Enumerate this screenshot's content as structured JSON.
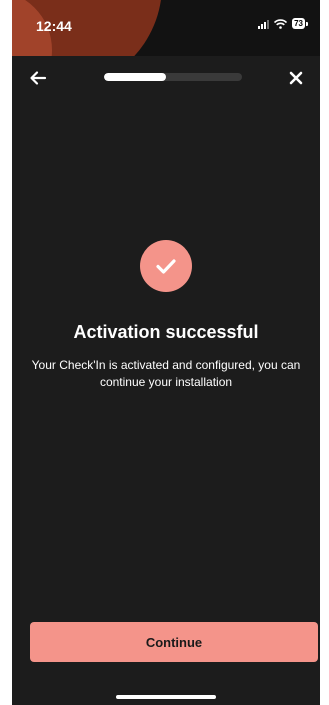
{
  "status_bar": {
    "time": "12:44",
    "battery": "73"
  },
  "progress": {
    "fraction": 0.45
  },
  "main": {
    "title": "Activation successful",
    "description": "Your Check'In is activated and configured, you can continue your installation"
  },
  "actions": {
    "continue_label": "Continue"
  },
  "colors": {
    "accent": "#f4948a",
    "background": "#1c1c1c"
  },
  "icons": {
    "back": "arrow-left-icon",
    "close": "close-icon",
    "success": "checkmark-icon"
  }
}
